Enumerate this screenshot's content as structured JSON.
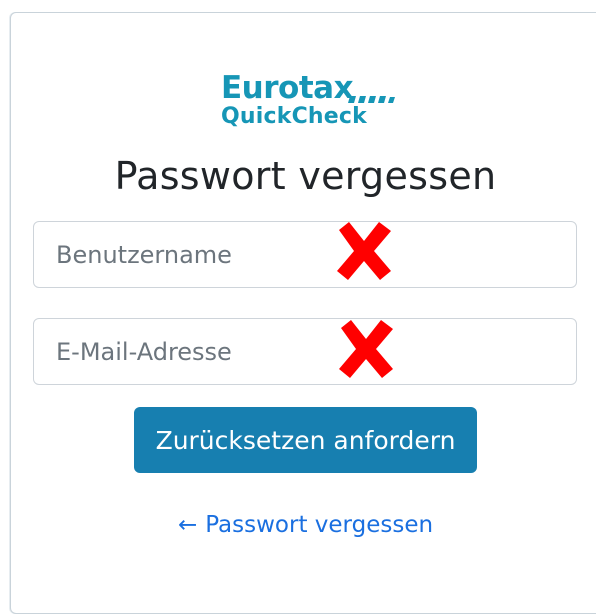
{
  "logo": {
    "line1": "Eurotax",
    "line2": "QuickCheck",
    "brand_color": "#1696b6"
  },
  "page_title": "Passwort vergessen",
  "form": {
    "username_placeholder": "Benutzername",
    "email_placeholder": "E-Mail-Adresse",
    "submit_label": "Zurücksetzen anfordern"
  },
  "annotations": {
    "cross_color": "#ff0000",
    "cross_icon": "red-x-mark"
  },
  "back_link": {
    "arrow": "←",
    "label": "Passwort vergessen"
  },
  "colors": {
    "button": "#177fb0",
    "link": "#1a6fe0",
    "title": "#212529"
  }
}
